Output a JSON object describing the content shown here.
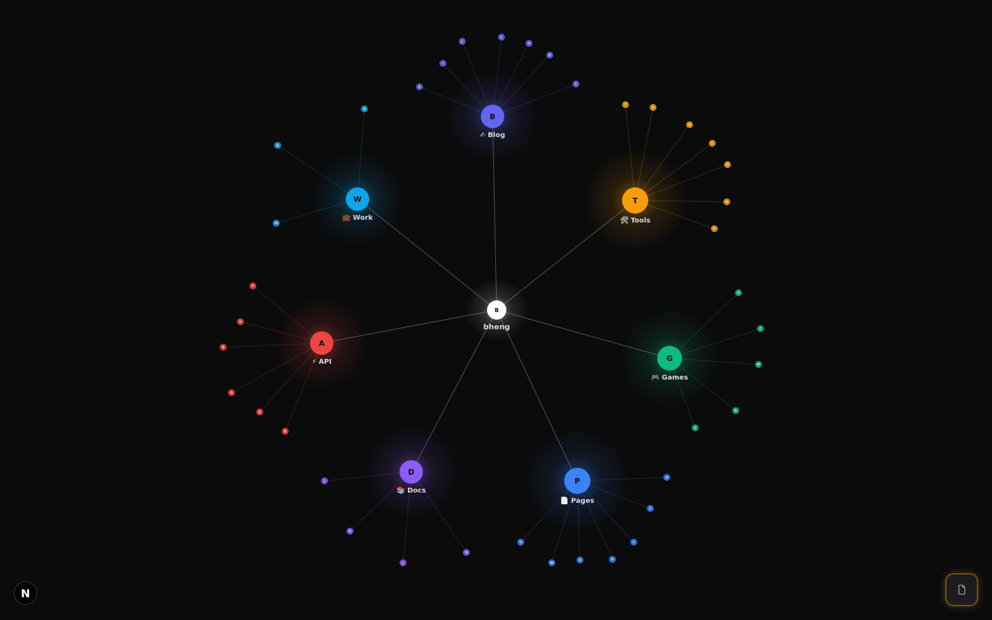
{
  "graph": {
    "center": {
      "letter": "B",
      "label": "bheng"
    },
    "clusters": [
      {
        "id": "blog",
        "letter": "B",
        "emoji": "✍",
        "label": "Blog",
        "color": "#6366f1",
        "leaves": [
          "E",
          "I",
          "J",
          "C",
          "G",
          "D",
          "C"
        ]
      },
      {
        "id": "tools",
        "letter": "T",
        "emoji": "🛠",
        "label": "Tools",
        "color": "#f59e0b",
        "leaves": [
          "T",
          "D",
          "G",
          "C",
          "H",
          "H",
          "R"
        ]
      },
      {
        "id": "work",
        "letter": "W",
        "emoji": "💼",
        "label": "Work",
        "color": "#0ea5e9",
        "leaves": [
          "A",
          "A",
          "M"
        ]
      },
      {
        "id": "api",
        "letter": "A",
        "emoji": "⚡",
        "label": "API",
        "color": "#ef4444",
        "leaves": [
          "P",
          "U",
          "B",
          "G",
          "G",
          "B"
        ]
      },
      {
        "id": "games",
        "letter": "G",
        "emoji": "🎮",
        "label": "Games",
        "color": "#10b981",
        "leaves": [
          "G",
          "C",
          "M",
          "R",
          "S"
        ]
      },
      {
        "id": "docs",
        "letter": "D",
        "emoji": "📚",
        "label": "Docs",
        "color": "#8b5cf6",
        "leaves": [
          "J",
          "R",
          "J",
          "B"
        ]
      },
      {
        "id": "pages",
        "letter": "P",
        "emoji": "📄",
        "label": "Pages",
        "color": "#3b82f6",
        "leaves": [
          "H",
          "C",
          "C",
          "P",
          "B",
          "W",
          "V"
        ]
      }
    ]
  },
  "footer": {
    "brand_letter": "N"
  }
}
